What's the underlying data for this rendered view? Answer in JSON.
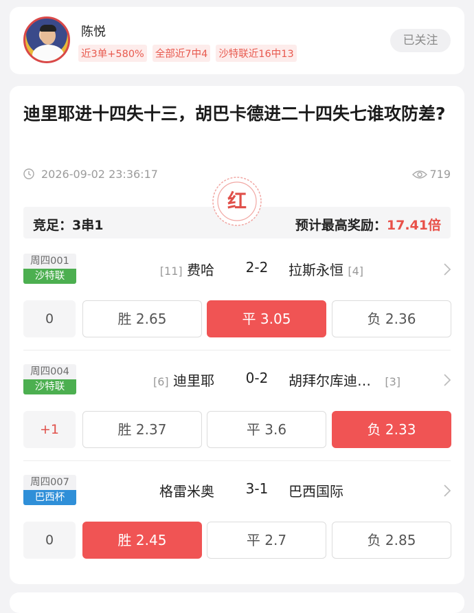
{
  "profile": {
    "name": "陈悦",
    "tags": [
      "近3单+580%",
      "全部近7中4",
      "沙特联近16中13"
    ],
    "follow_label": "已关注"
  },
  "article": {
    "title": "迪里耶进十四失十三，胡巴卡德进二十四失七谁攻防差?",
    "time": "2026-09-02 23:36:17",
    "views": "719",
    "stamp": "红",
    "play": "竞足：3串1",
    "reward_label": "预计最高奖励：",
    "reward_value": "17.41倍"
  },
  "matches": [
    {
      "code": "周四001",
      "league": "沙特联",
      "league_color": "#4caf50",
      "home_rank": "[11]",
      "home": "费哈",
      "score": "2-2",
      "away": "拉斯永恒",
      "away_rank": "[4]",
      "handicap": "0",
      "handicap_red": false,
      "odds": [
        {
          "label": "胜 2.65",
          "selected": false
        },
        {
          "label": "平 3.05",
          "selected": true
        },
        {
          "label": "负 2.36",
          "selected": false
        }
      ]
    },
    {
      "code": "周四004",
      "league": "沙特联",
      "league_color": "#4caf50",
      "home_rank": "[6]",
      "home": "迪里耶",
      "score": "0-2",
      "away": "胡拜尔库迪…",
      "away_rank": "[3]",
      "handicap": "+1",
      "handicap_red": true,
      "odds": [
        {
          "label": "胜 2.37",
          "selected": false
        },
        {
          "label": "平 3.6",
          "selected": false
        },
        {
          "label": "负 2.33",
          "selected": true
        }
      ]
    },
    {
      "code": "周四007",
      "league": "巴西杯",
      "league_color": "#2f8fd8",
      "home_rank": "",
      "home": "格雷米奥",
      "score": "3-1",
      "away": "巴西国际",
      "away_rank": "",
      "handicap": "0",
      "handicap_red": false,
      "odds": [
        {
          "label": "胜 2.45",
          "selected": true
        },
        {
          "label": "平 2.7",
          "selected": false
        },
        {
          "label": "负 2.85",
          "selected": false
        }
      ]
    }
  ],
  "colors": {
    "accent": "#f05454",
    "tag_text": "#e85a4f",
    "tag_bg": "#fdeceb"
  }
}
